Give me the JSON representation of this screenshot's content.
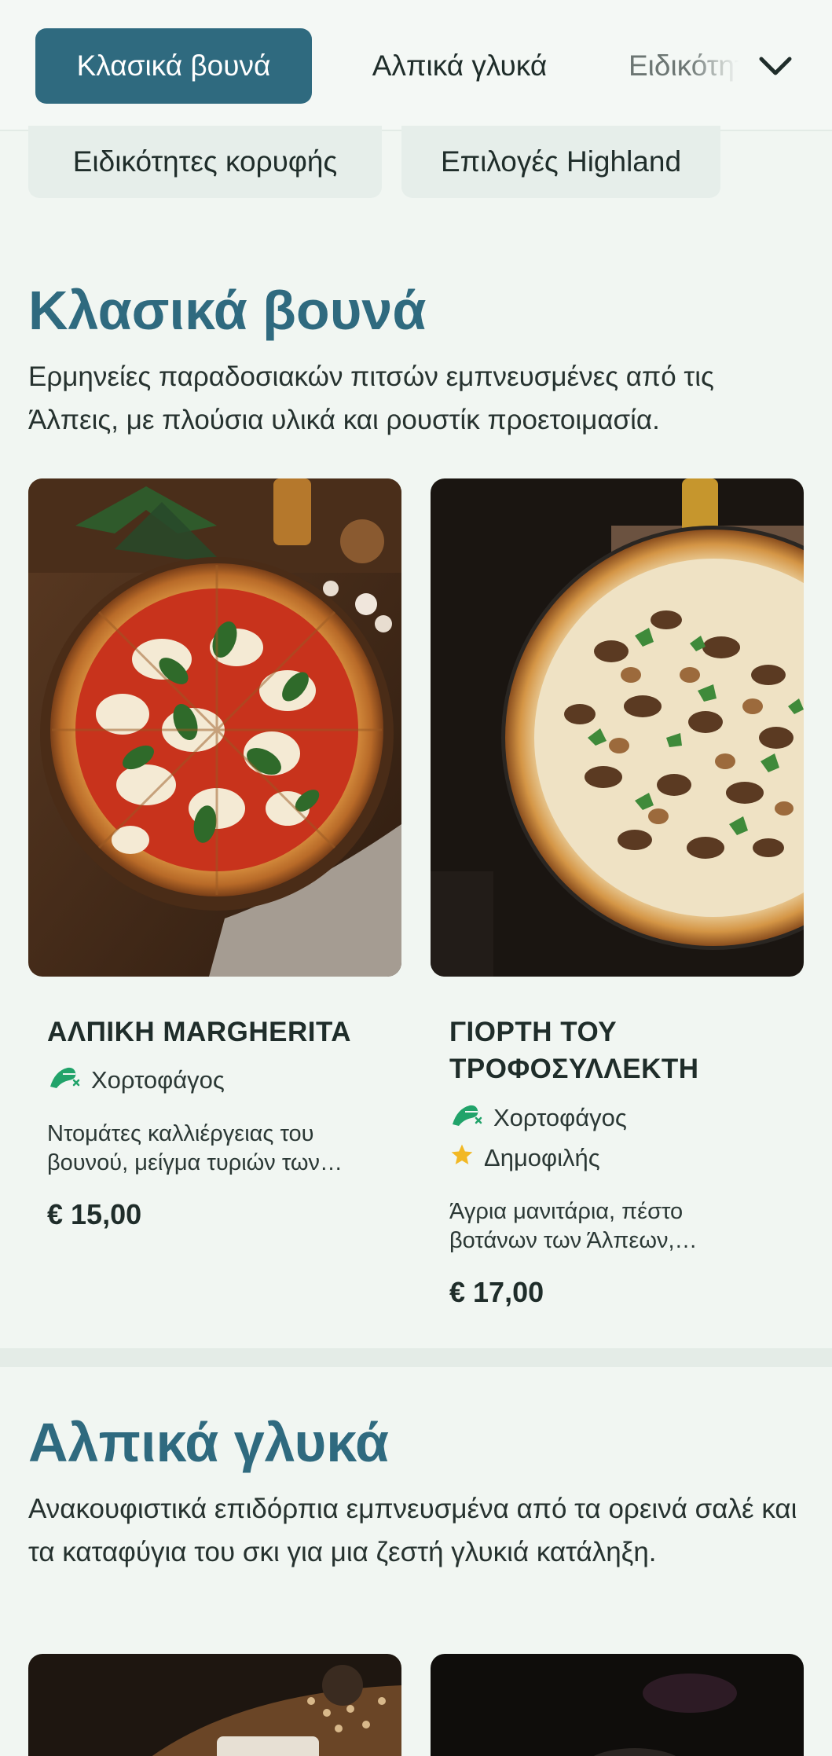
{
  "category_nav": {
    "tabs": [
      "Κλασικά βουνά",
      "Αλπικά γλυκά",
      "Ειδικότητες κορυφής"
    ],
    "subchips": [
      "Ειδικότητες κορυφής",
      "Επιλογές Highland"
    ],
    "expand_icon": "chevron-down-icon"
  },
  "sections": [
    {
      "title": "Κλασικά βουνά",
      "description": "Ερμηνείες παραδοσιακών πιτσών εμπνευσμένες από τις Άλπεις, με πλούσια υλικά και ρουστίκ προετοιμασία.",
      "items": [
        {
          "name": "ΑΛΠΙΚΗ MARGHERITA",
          "tags": [
            {
              "icon": "vegetarian-icon",
              "label": "Χορτοφάγος"
            }
          ],
          "description_lines": [
            "Ντομάτες καλλιέργειας του",
            "βουνού, μείγμα τυριών των…"
          ],
          "price": "€ 15,00"
        },
        {
          "name_lines": [
            "ΓΙΟΡΤΗ ΤΟΥ",
            "ΤΡΟΦΟΣΥΛΛΕΚΤΗ"
          ],
          "tags": [
            {
              "icon": "vegetarian-icon",
              "label": "Χορτοφάγος"
            },
            {
              "icon": "star-icon",
              "label": "Δημοφιλής"
            }
          ],
          "description_lines": [
            "Άγρια μανιτάρια, πέστο",
            "βοτάνων των Άλπεων,…"
          ],
          "price": "€ 17,00"
        }
      ]
    },
    {
      "title": "Αλπικά γλυκά",
      "description": "Ανακουφιστικά επιδόρπια εμπνευσμένα από τα ορεινά σαλέ και τα καταφύγια του σκι για μια ζεστή γλυκιά κατάληξη."
    }
  ],
  "colors": {
    "accent": "#2f6a7f",
    "background": "#f1f6f2",
    "vegetarian_green": "#21a36a",
    "star_yellow": "#f2b824"
  }
}
